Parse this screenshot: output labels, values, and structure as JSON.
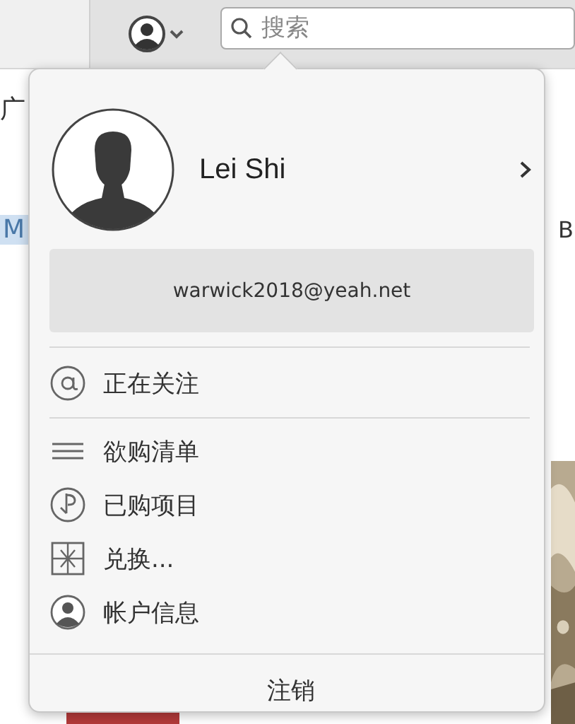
{
  "toolbar": {
    "search": {
      "placeholder": "搜索"
    }
  },
  "background": {
    "texts": [
      "广",
      "M",
      "B"
    ]
  },
  "account_menu": {
    "name": "Lei Shi",
    "email": "warwick2018@yeah.net",
    "items": [
      {
        "kind": "at",
        "label": "正在关注"
      },
      {
        "kind": "list",
        "label": "欲购清单"
      },
      {
        "kind": "purchased",
        "label": "已购项目"
      },
      {
        "kind": "gift",
        "label": "兑换..."
      },
      {
        "kind": "person",
        "label": "帐户信息"
      }
    ],
    "sign_out": "注销"
  }
}
